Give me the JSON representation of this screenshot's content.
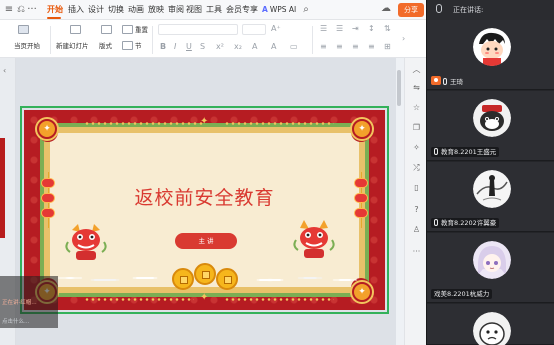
{
  "menubar": {
    "items": [
      "开始",
      "插入",
      "设计",
      "切换",
      "动画",
      "放映",
      "审阅",
      "视图",
      "工具",
      "会员专享"
    ],
    "active_index": 0,
    "ai_label": "WPS AI",
    "share_label": "分享"
  },
  "ribbon": {
    "from_current": "当页开始",
    "new_slide": "新建幻灯片",
    "layout": "版式",
    "section": "节",
    "reset": "重置"
  },
  "slide": {
    "title": "返校前安全教育",
    "presenter_label": "主 讲"
  },
  "overlay": {
    "line1": "正在讲·红帽…",
    "line2": "点击什么…"
  },
  "meeting": {
    "header": "正在讲话:",
    "participants": [
      {
        "name": "王琦",
        "is_host": true
      },
      {
        "name": "教育8.2201王盛元",
        "is_host": false
      },
      {
        "name": "教育8.2202许翼豪",
        "is_host": false
      },
      {
        "name": "戏美8.2201杭威力",
        "is_host": false
      },
      {
        "name": "",
        "is_host": false
      }
    ]
  },
  "colors": {
    "accent_orange": "#f26b2a",
    "slide_red": "#b61c22",
    "selection_green": "#33b15a",
    "title_red": "#d93a31"
  }
}
